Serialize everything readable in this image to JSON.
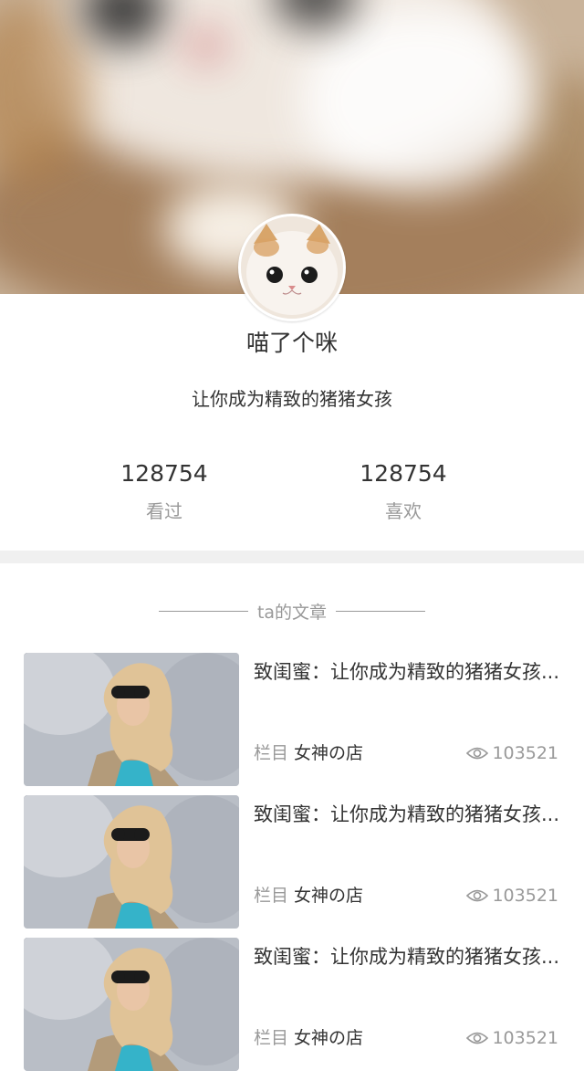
{
  "profile": {
    "name": "喵了个咪",
    "bio": "让你成为精致的猪猪女孩"
  },
  "stats": {
    "views": {
      "value": "128754",
      "label": "看过"
    },
    "likes": {
      "value": "128754",
      "label": "喜欢"
    }
  },
  "section": {
    "title": "ta的文章"
  },
  "articles": [
    {
      "title": "致闺蜜：让你成为精致的猪猪女孩...",
      "column_label": "栏目",
      "column_name": "女神の店",
      "views": "103521"
    },
    {
      "title": "致闺蜜：让你成为精致的猪猪女孩...",
      "column_label": "栏目",
      "column_name": "女神の店",
      "views": "103521"
    },
    {
      "title": "致闺蜜：让你成为精致的猪猪女孩...",
      "column_label": "栏目",
      "column_name": "女神の店",
      "views": "103521"
    }
  ],
  "icons": {
    "views": "eye-icon"
  },
  "colors": {
    "text_primary": "#333333",
    "text_secondary": "#999999",
    "band": "#f0f0f0"
  }
}
